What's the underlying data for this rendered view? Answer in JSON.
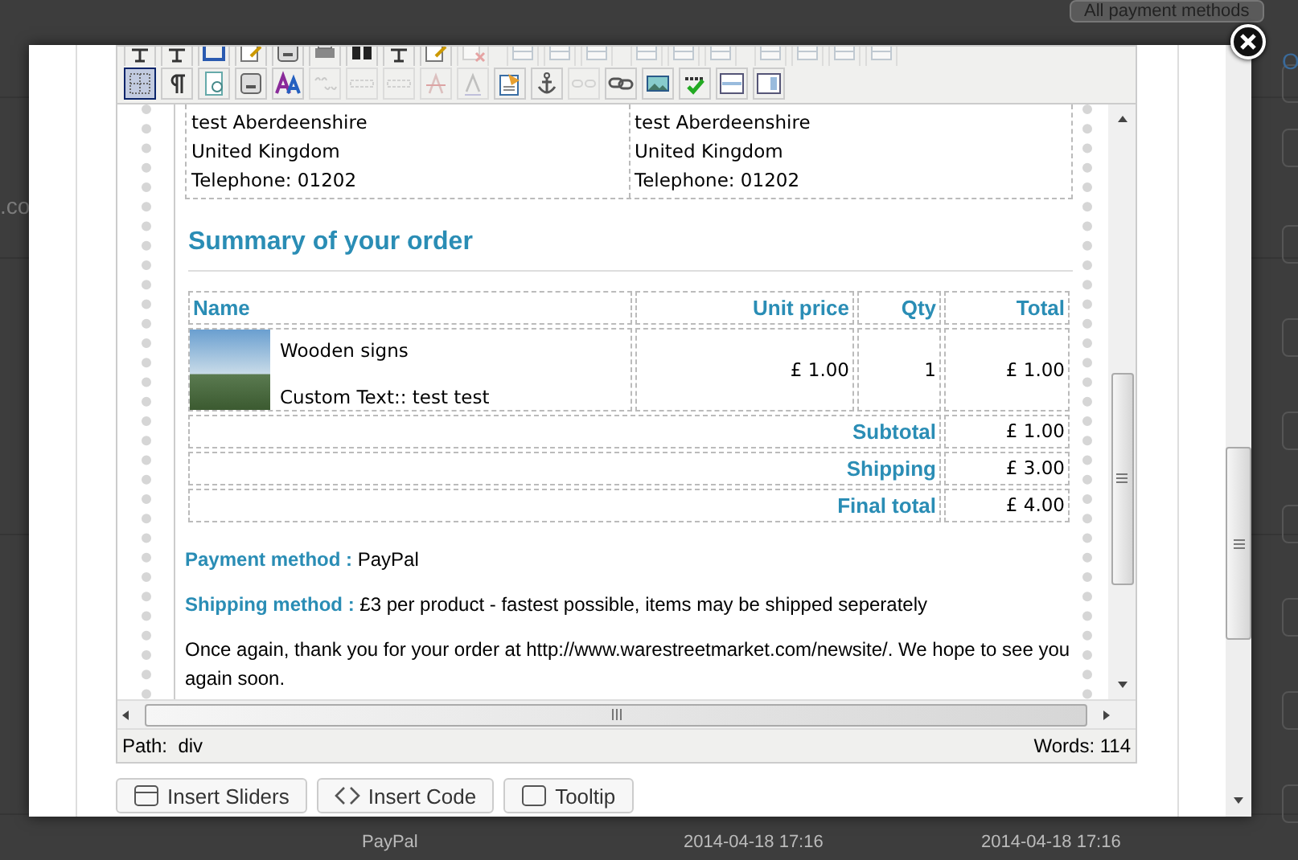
{
  "background": {
    "select": "All payment methods",
    "left_text": ".co",
    "right_link": "O",
    "bottom_cells": [
      "PayPal",
      "2014-04-18 17:16",
      "2014-04-18 17:16"
    ]
  },
  "editor": {
    "toolbar_row_1": [
      {
        "kind": "text",
        "disabled": false
      },
      {
        "kind": "text",
        "disabled": false
      },
      {
        "kind": "frame",
        "disabled": false
      },
      {
        "kind": "edit",
        "disabled": false
      },
      {
        "kind": "box",
        "disabled": false
      },
      {
        "kind": "print",
        "disabled": false
      },
      {
        "kind": "dark",
        "disabled": false
      },
      {
        "kind": "text",
        "disabled": false
      },
      {
        "kind": "edit",
        "disabled": false
      },
      {
        "kind": "delete",
        "disabled": true
      },
      {
        "kind": "table",
        "disabled": true
      },
      {
        "kind": "table",
        "disabled": true
      },
      {
        "kind": "table",
        "disabled": true
      },
      {
        "kind": "table",
        "disabled": true
      },
      {
        "kind": "table",
        "disabled": true
      },
      {
        "kind": "table",
        "disabled": true
      },
      {
        "kind": "table",
        "disabled": true
      },
      {
        "kind": "table",
        "disabled": true
      },
      {
        "kind": "table",
        "disabled": true
      },
      {
        "kind": "table",
        "disabled": true
      }
    ],
    "toolbar_row_2": [
      {
        "kind": "visual-aid",
        "selected": true,
        "disabled": false
      },
      {
        "kind": "pilcrow",
        "selected": false,
        "disabled": false
      },
      {
        "kind": "preview",
        "selected": false,
        "disabled": false
      },
      {
        "kind": "box",
        "selected": false,
        "disabled": false
      },
      {
        "kind": "styles",
        "selected": false,
        "disabled": false
      },
      {
        "kind": "quote",
        "selected": false,
        "disabled": true
      },
      {
        "kind": "abbr",
        "selected": false,
        "disabled": true
      },
      {
        "kind": "acronym",
        "selected": false,
        "disabled": true
      },
      {
        "kind": "strike",
        "selected": false,
        "disabled": true
      },
      {
        "kind": "letter",
        "selected": false,
        "disabled": true
      },
      {
        "kind": "clipboard",
        "selected": false,
        "disabled": false
      },
      {
        "kind": "anchor",
        "selected": false,
        "disabled": false
      },
      {
        "kind": "unlink",
        "selected": false,
        "disabled": true
      },
      {
        "kind": "link",
        "selected": false,
        "disabled": false
      },
      {
        "kind": "image",
        "selected": false,
        "disabled": false
      },
      {
        "kind": "spellcheck",
        "selected": false,
        "disabled": false
      },
      {
        "kind": "rule",
        "selected": false,
        "disabled": false
      },
      {
        "kind": "panel",
        "selected": false,
        "disabled": false
      }
    ],
    "addresses": [
      {
        "lines": [
          "test Aberdeenshire",
          "United Kingdom",
          "Telephone: 01202"
        ]
      },
      {
        "lines": [
          "test Aberdeenshire",
          "United Kingdom",
          "Telephone: 01202"
        ]
      }
    ],
    "summary_heading": "Summary of your order",
    "order_table": {
      "columns": [
        "Name",
        "Unit price",
        "Qty",
        "Total"
      ],
      "rows": [
        {
          "name": "Wooden signs",
          "custom_text": "Custom Text:: test test",
          "unit_price": "£ 1.00",
          "qty": "1",
          "total": "£ 1.00"
        }
      ],
      "totals": [
        {
          "label": "Subtotal",
          "value": "£ 1.00"
        },
        {
          "label": "Shipping",
          "value": "£ 3.00"
        },
        {
          "label": "Final total",
          "value": "£ 4.00"
        }
      ]
    },
    "payment_method": {
      "label": "Payment method :",
      "value": "PayPal"
    },
    "shipping_method": {
      "label": "Shipping method :",
      "value": "£3 per product - fastest possible, items may be shipped seperately"
    },
    "closing_text": "Once again, thank you for your order at http://www.warestreetmarket.com/newsite/. We hope to see you again soon.",
    "status_bar": {
      "path_label": "Path:",
      "path": "div",
      "words": "Words: 114"
    }
  },
  "buttons": [
    {
      "kind": "sliders",
      "label": "Insert Sliders"
    },
    {
      "kind": "code",
      "label": "Insert Code"
    },
    {
      "kind": "tooltip",
      "label": "Tooltip"
    }
  ]
}
